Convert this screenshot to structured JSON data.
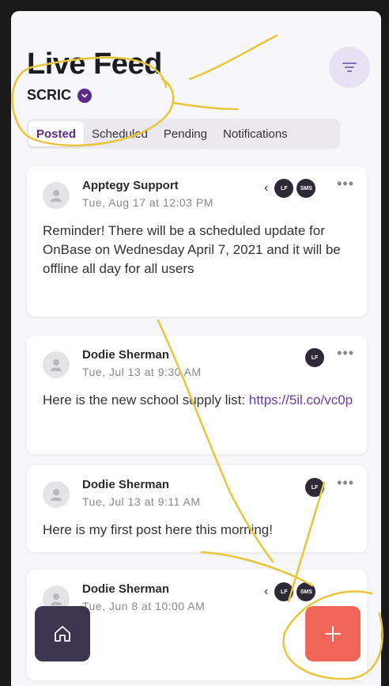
{
  "header": {
    "title": "Live Feed",
    "org": "SCRIC"
  },
  "tabs": [
    {
      "label": "Posted",
      "active": true
    },
    {
      "label": "Scheduled",
      "active": false
    },
    {
      "label": "Pending",
      "active": false
    },
    {
      "label": "Notifications",
      "active": false
    }
  ],
  "posts": [
    {
      "author": "Apptegy Support",
      "date": "Tue, Aug 17 at 12:03 PM",
      "text": "Reminder! There will be a scheduled update for OnBase on Wednesday April 7, 2021 and it will be offline all day for all users",
      "badges": [
        "LF",
        "SMS"
      ],
      "more": "•••"
    },
    {
      "author": "Dodie Sherman",
      "date": "Tue, Jul 13 at 9:30 AM",
      "text": "Here is the new school supply list: ",
      "link": "https://5il.co/vc0p",
      "badges": [
        "LF"
      ],
      "more": "•••"
    },
    {
      "author": "Dodie Sherman",
      "date": "Tue, Jul 13 at 9:11 AM",
      "text": "Here is my first post here this morning!",
      "badges": [
        "LF"
      ],
      "more": "•••"
    },
    {
      "author": "Dodie Sherman",
      "date": "Tue, Jun 8 at 10:00 AM",
      "badges": [
        "LF",
        "SMS"
      ]
    }
  ],
  "icons": {
    "filter": "filter-icon",
    "org": "chevron-down-icon",
    "avatar": "user-icon",
    "expand": "chevron-left-icon",
    "home": "home-icon",
    "add": "plus-icon"
  },
  "colors": {
    "accent": "#5b2a86",
    "add_button": "#ef6659",
    "home_button": "#3d3650",
    "badge": "#2d2a36",
    "annotation": "#e8c53a"
  }
}
